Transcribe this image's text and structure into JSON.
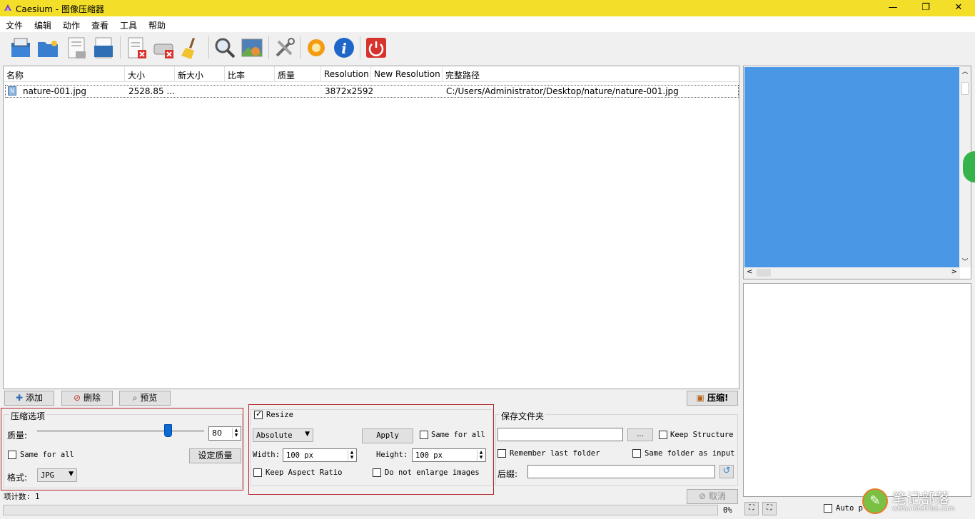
{
  "window": {
    "title": "Caesium - 图像压缩器",
    "minimize": "—",
    "maximize": "❐",
    "close": "✕"
  },
  "menu": [
    "文件",
    "编辑",
    "动作",
    "查看",
    "工具",
    "帮助"
  ],
  "toolbar_icons": [
    "open-icon",
    "open-folder-icon",
    "save-icon",
    "save-as-icon",
    "remove-item-icon",
    "remove-all-icon",
    "clear-list-icon",
    "search-icon",
    "preview-icon",
    "settings-icon",
    "update-icon",
    "info-icon",
    "exit-icon"
  ],
  "file_list": {
    "columns": [
      "名称",
      "大小",
      "新大小",
      "比率",
      "质量",
      "Resolution",
      "New Resolution",
      "完整路径"
    ],
    "rows": [
      {
        "name": "nature-001.jpg",
        "size": "2528.85 ...",
        "new_size": "",
        "ratio": "",
        "quality": "",
        "resolution": "3872x2592",
        "new_resolution": "",
        "path": "C:/Users/Administrator/Desktop/nature/nature-001.jpg"
      }
    ]
  },
  "actions": {
    "add": "添加",
    "delete": "删除",
    "preview": "预览",
    "compress": "压缩!"
  },
  "compression": {
    "group_title": "压缩选项",
    "quality_label": "质量:",
    "quality_value": "80",
    "quality_slider": 80,
    "same_for_all": "Same for all",
    "set_quality": "设定质量",
    "format_label": "格式:",
    "format_value": "JPG"
  },
  "resize": {
    "enabled_label": "Resize",
    "mode": "Absolute",
    "apply": "Apply",
    "same_for_all": "Same for all",
    "width_label": "Width:",
    "width_value": "100 px",
    "height_label": "Height:",
    "height_value": "100 px",
    "keep_aspect": "Keep Aspect Ratio",
    "no_enlarge": "Do not enlarge images"
  },
  "output": {
    "group_title": "保存文件夹",
    "folder_value": "",
    "browse": "...",
    "keep_structure": "Keep Structure",
    "remember_last": "Remember last folder",
    "same_as_input": "Same folder as input",
    "suffix_label": "后缀:",
    "suffix_value": ""
  },
  "status": {
    "item_count": "项计数: 1",
    "cancel": "取消",
    "progress": "0%",
    "auto_preview": "Auto p"
  },
  "watermark": {
    "line1": "笔记部落",
    "line2": "www.notetribe.com"
  },
  "colors": {
    "titlebar": "#f3df2a",
    "preview_fill": "#4a97e6",
    "highlight_box": "#b1252b"
  }
}
